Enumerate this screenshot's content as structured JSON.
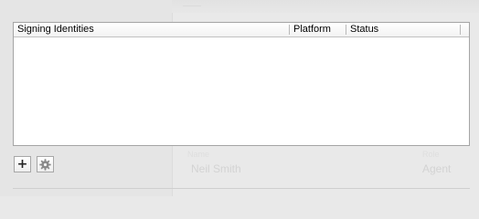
{
  "table": {
    "columns": [
      {
        "label": "Signing Identities"
      },
      {
        "label": "Platform"
      },
      {
        "label": "Status"
      }
    ],
    "rows": []
  },
  "toolbar": {
    "add_icon": "plus-icon",
    "action_icon": "gear-icon"
  },
  "background": {
    "ghost_name": "Neil Smith",
    "ghost_role": "Agent"
  }
}
